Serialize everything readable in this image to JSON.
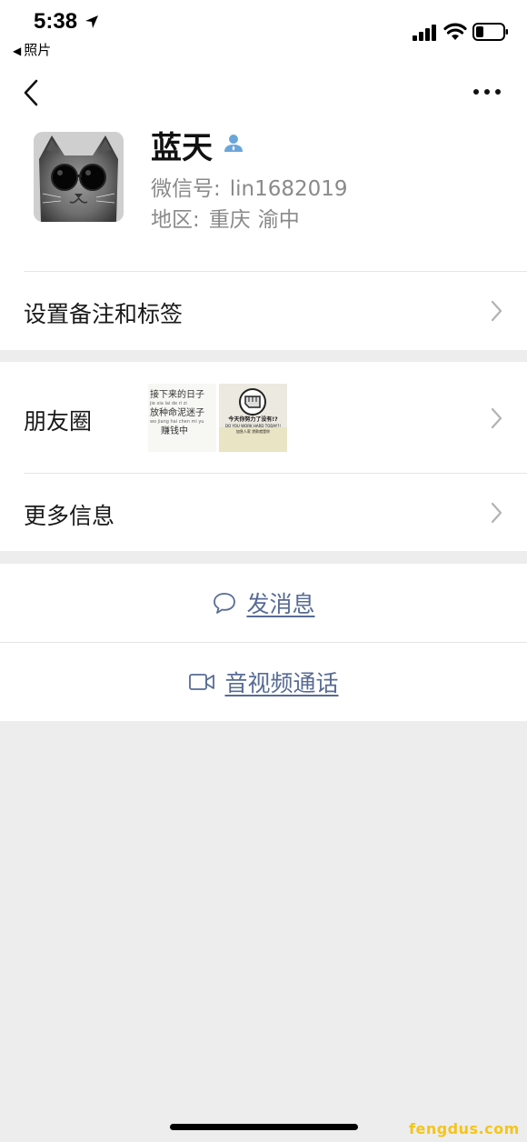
{
  "status_bar": {
    "time": "5:38",
    "back_app_label": "照片",
    "battery_icon": "battery-low-icon",
    "wifi_icon": "wifi-icon",
    "signal_icon": "cellular-signal-icon"
  },
  "nav": {
    "back_icon": "chevron-left-icon",
    "more_icon": "more-dots-icon"
  },
  "profile": {
    "name": "蓝天",
    "wechat_id_label": "微信号:",
    "wechat_id": "lin1682019",
    "region_label": "地区:",
    "region_city": "重庆",
    "region_district": "渝中",
    "avatar_description_icon": "cat-sunglasses-avatar"
  },
  "menu": {
    "remark_label": "设置备注和标签",
    "moments_label": "朋友圈",
    "more_info_label": "更多信息",
    "moments_thumb1_lines": [
      "接下来的日子",
      "jie xia lai de ri zi",
      "放种命泥迷子",
      "wo jiang hai chen mi yu",
      "赚钱中"
    ],
    "moments_thumb2_lines": [
      "今天你努力了没有!?",
      "DO YOU WORK HARD TODAY?!",
      "加急人家 贷款就是你"
    ]
  },
  "actions": {
    "message_label": "发消息",
    "call_label": "音视频通话"
  },
  "watermark": "fengdus.com",
  "colors": {
    "link": "#576b95",
    "secondary_text": "#8a8a8a",
    "background": "#ededed",
    "person_icon": "#6aa6d9",
    "watermark": "#f5c518"
  }
}
